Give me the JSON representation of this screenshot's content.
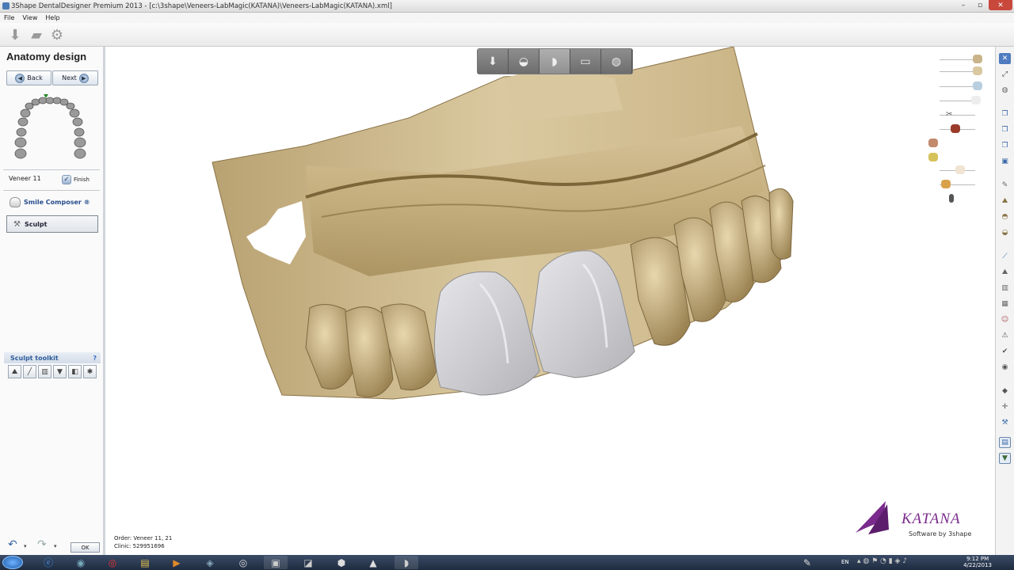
{
  "window": {
    "title": "3Shape DentalDesigner Premium 2013 - [c:\\3shape\\Veneers-LabMagic(KATANA)\\Veneers-LabMagic(KATANA).xml]"
  },
  "menu": [
    "File",
    "View",
    "Help"
  ],
  "panel": {
    "title": "Anatomy design",
    "back_label": "Back",
    "next_label": "Next",
    "veneer_label": "Veneer 11",
    "finish_label": "Finish",
    "smile_label": "Smile Composer ®",
    "sculpt_label": "Sculpt",
    "toolkit_label": "Sculpt toolkit",
    "toolkit_help": "?",
    "ok_label": "OK"
  },
  "order": {
    "order_line": "Order:   Veneer 11, 21",
    "clinic_line": "Clinic:   529951696"
  },
  "brand": {
    "logo_text": "KATANA",
    "tagline": "Software by 3shape",
    "accent": "#7a2a8c"
  },
  "taskbar": {
    "lang": "EN",
    "time": "9:12 PM",
    "date": "4/22/2013"
  },
  "colors": {
    "model": "#c9b48a",
    "veneer": "#cfcfd3",
    "taskbar": "#24324a"
  }
}
